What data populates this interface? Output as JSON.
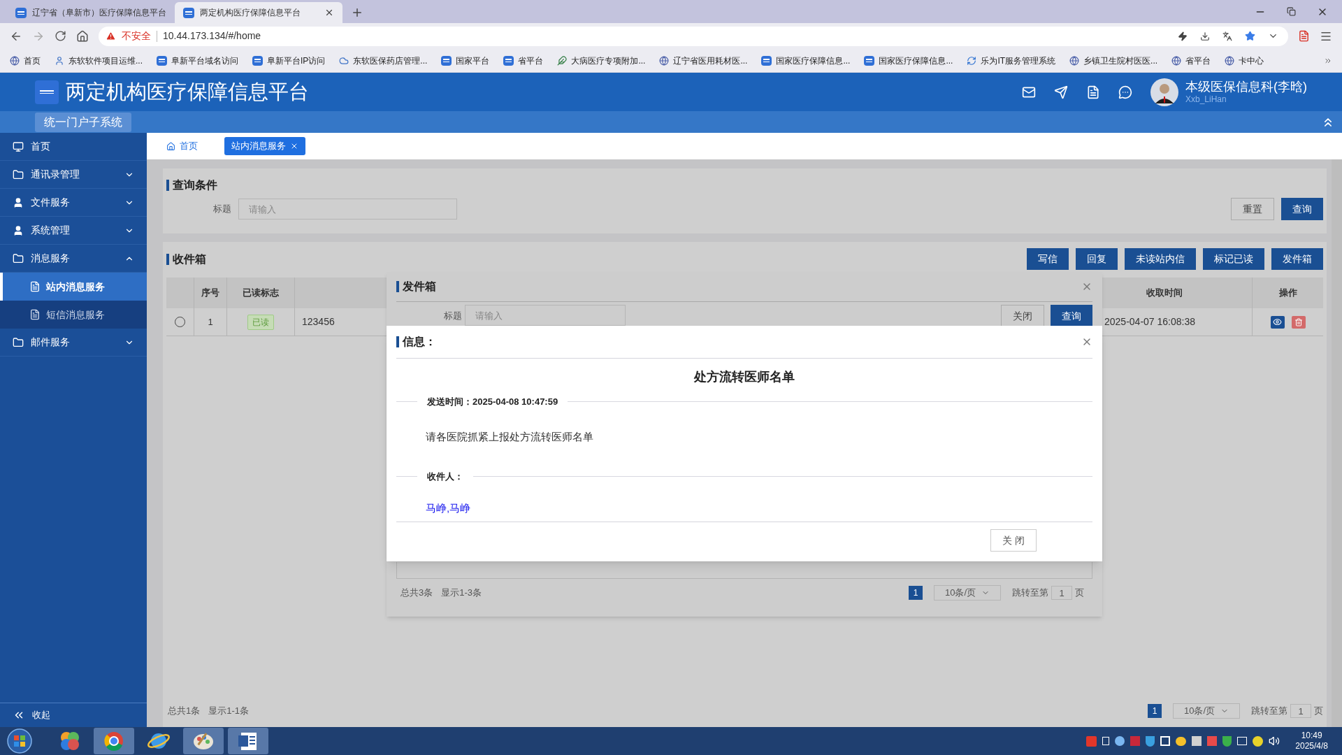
{
  "browser": {
    "tabs": [
      {
        "title": "辽宁省（阜新市）医疗保障信息平台",
        "selected": false
      },
      {
        "title": "两定机构医疗保障信息平台",
        "selected": true
      }
    ],
    "address": {
      "security": "不安全",
      "url": "10.44.173.134/#/home"
    },
    "bookmarks": [
      {
        "label": "首页",
        "kind": "globe"
      },
      {
        "label": "东软软件项目运维...",
        "kind": "person"
      },
      {
        "label": "阜新平台域名访问",
        "kind": "chs"
      },
      {
        "label": "阜新平台IP访问",
        "kind": "chs"
      },
      {
        "label": "东软医保药店管理...",
        "kind": "cloud"
      },
      {
        "label": "国家平台",
        "kind": "chs"
      },
      {
        "label": "省平台",
        "kind": "chs"
      },
      {
        "label": "大病医疗专项附加...",
        "kind": "feather"
      },
      {
        "label": "辽宁省医用耗材医...",
        "kind": "globe"
      },
      {
        "label": "国家医疗保障信息...",
        "kind": "chs"
      },
      {
        "label": "国家医疗保障信息...",
        "kind": "chs"
      },
      {
        "label": "乐为IT服务管理系统",
        "kind": "refresh"
      },
      {
        "label": "乡镇卫生院村医医...",
        "kind": "globe"
      },
      {
        "label": "省平台",
        "kind": "globe"
      },
      {
        "label": "卡中心",
        "kind": "globe"
      }
    ]
  },
  "header": {
    "title": "两定机构医疗保障信息平台",
    "subsystem": "统一门户子系统",
    "user": {
      "name": "本级医保信息科(李晗)",
      "account": "Xxb_LiHan"
    }
  },
  "sidebar": {
    "items": [
      {
        "label": "首页",
        "kind": "link"
      },
      {
        "label": "通讯录管理",
        "kind": "group",
        "expanded": false
      },
      {
        "label": "文件服务",
        "kind": "group",
        "expanded": false
      },
      {
        "label": "系统管理",
        "kind": "group",
        "expanded": false
      },
      {
        "label": "消息服务",
        "kind": "group",
        "expanded": true,
        "children": [
          {
            "label": "站内消息服务",
            "selected": true
          },
          {
            "label": "短信消息服务",
            "selected": false
          }
        ]
      },
      {
        "label": "邮件服务",
        "kind": "group",
        "expanded": false
      }
    ],
    "collapse_label": "收起"
  },
  "tabs": [
    {
      "label": "首页",
      "kind": "home",
      "selected": false
    },
    {
      "label": "站内消息服务",
      "kind": "closable",
      "selected": true
    }
  ],
  "query": {
    "title": "查询条件",
    "field_label": "标题",
    "placeholder": "请输入",
    "buttons": [
      "重置",
      "查询"
    ]
  },
  "inbox": {
    "title": "收件箱",
    "buttons": [
      "写信",
      "回复",
      "未读站内信",
      "标记已读",
      "发件箱"
    ],
    "columns": [
      "序号",
      "已读标志",
      "收取时间",
      "操作"
    ],
    "rows": [
      {
        "selected": false,
        "index": "1",
        "read": true,
        "read_label": "已读",
        "title": "123456",
        "time": "2025-04-07 16:08:38"
      }
    ],
    "footer": {
      "total": "总共1条",
      "showing": "显示1-1条",
      "page": "1",
      "page_size": "10条/页",
      "jump_label": "跳转至第",
      "jump_value": "1",
      "page_suffix": "页"
    }
  },
  "outbox_dialog": {
    "title": "发件箱",
    "field_label": "标题",
    "placeholder": "请输入",
    "buttons": [
      "关闭",
      "查询"
    ],
    "footer": {
      "total": "总共3条",
      "showing": "显示1-3条",
      "page": "1",
      "page_size": "10条/页",
      "jump_label": "跳转至第",
      "jump_value": "1",
      "page_suffix": "页"
    }
  },
  "info_dialog": {
    "title": "信息：",
    "heading": "处方流转医师名单",
    "sent": "发送时间：2025-04-08 10:47:59",
    "body": "请各医院抓紧上报处方流转医师名单",
    "recipients_label": "收件人：",
    "recipients": "马峥,马峥",
    "close_button": "关 闭"
  },
  "taskbar": {
    "time": "10:49",
    "date": "2025/4/8"
  }
}
